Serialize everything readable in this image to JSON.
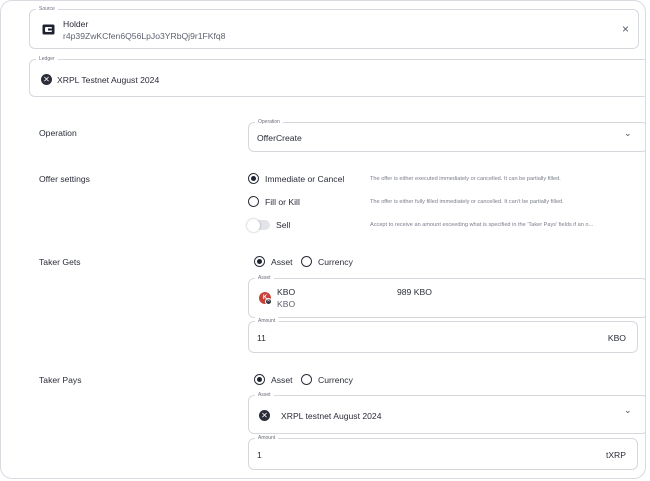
{
  "source": {
    "legend": "Source",
    "account_name": "Holder",
    "account_address": "r4p39ZwKCfen6Q56LpJo3YRbQj9r1FKfq8"
  },
  "ledger": {
    "legend": "Ledger",
    "value": "XRPL Testnet August 2024"
  },
  "operation": {
    "label": "Operation",
    "legend": "Operation",
    "value": "OfferCreate"
  },
  "offer_settings": {
    "label": "Offer settings",
    "options": [
      {
        "label": "Immediate or Cancel",
        "description": "The offer is either executed immediately or cancelled. It can be partially filled.",
        "selected": true
      },
      {
        "label": "Fill or Kill",
        "description": "The offer is either fully filled immediately or cancelled. It can't be partially filled.",
        "selected": false
      }
    ],
    "sell": {
      "label": "Sell",
      "description": "Accept to receive an amount exceeding what is specified in the 'Taker Pays' fields if an o...",
      "enabled": false
    }
  },
  "taker_gets": {
    "label": "Taker Gets",
    "asset_option": "Asset",
    "currency_option": "Currency",
    "asset_legend": "Asset",
    "asset_code": "KBO",
    "asset_sub": "KBO",
    "asset_balance": "989 KBO",
    "token_letter": "K",
    "amount_legend": "Amount",
    "amount_value": "11",
    "amount_unit": "KBO"
  },
  "taker_pays": {
    "label": "Taker Pays",
    "asset_option": "Asset",
    "currency_option": "Currency",
    "asset_legend": "Asset",
    "asset_value": "XRPL testnet August 2024",
    "amount_legend": "Amount",
    "amount_value": "1",
    "amount_unit": "tXRP"
  },
  "icons": {
    "close": "×",
    "chevron": "⌄",
    "x_mark": "✕"
  }
}
